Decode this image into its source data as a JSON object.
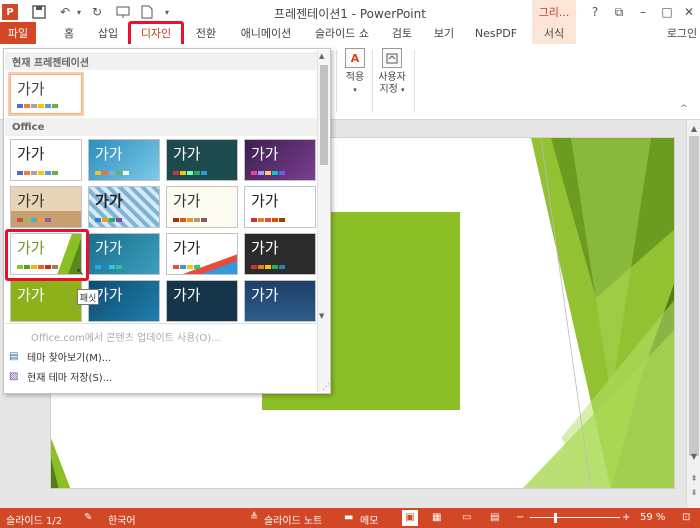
{
  "window": {
    "title": "프레젠테이션1 - PowerPoint",
    "context_tab_top": "그리...",
    "buttons": [
      "?",
      "⧉",
      "–",
      "□",
      "✕"
    ]
  },
  "quick_access": [
    "P",
    "💾",
    "↶",
    "↻",
    "🎞",
    "🗋",
    "▾"
  ],
  "ribbon_tabs": [
    {
      "label": "파일"
    },
    {
      "label": "홈"
    },
    {
      "label": "삽입"
    },
    {
      "label": "디자인"
    },
    {
      "label": "전환"
    },
    {
      "label": "애니메이션"
    },
    {
      "label": "슬라이드 쇼"
    },
    {
      "label": "검토"
    },
    {
      "label": "보기"
    },
    {
      "label": "NesPDF"
    },
    {
      "label": "서식"
    },
    {
      "label": "로그인"
    }
  ],
  "ribbon": {
    "apply_label": "적용",
    "custom_label_1": "사용자",
    "custom_label_2": "지정"
  },
  "gallery": {
    "section_current": "현재 프레젠테이션",
    "section_office": "Office",
    "thumb_text": "가가",
    "tooltip": "패싯",
    "menu": [
      {
        "label": "Office.com에서 콘텐츠 업데이트 사용(O)...",
        "disabled": true
      },
      {
        "label": "테마 찾아보기(M)...",
        "disabled": false
      },
      {
        "label": "현재 테마 저장(S)...",
        "disabled": false
      }
    ]
  },
  "statusbar": {
    "slide_info": "슬라이드 1/2",
    "language": "한국어",
    "notes": "슬라이드 노트",
    "comments": "메모",
    "zoom": "59 %"
  }
}
